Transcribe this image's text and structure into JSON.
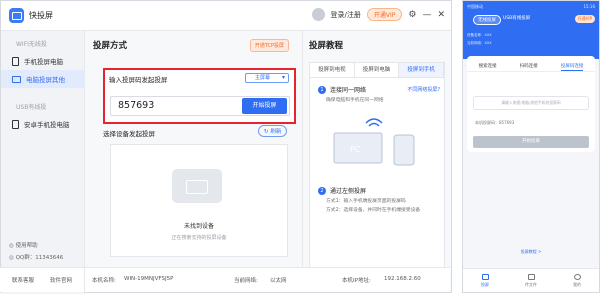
{
  "app": {
    "name": "快投屏"
  },
  "header": {
    "login_label": "登录/注册",
    "vip_label": "开通VIP"
  },
  "sidebar": {
    "section_wifi": "WIFI无线投",
    "items": [
      {
        "label": "手机投屏电脑"
      },
      {
        "label": "电脑投屏其他"
      }
    ],
    "section_usb": "USB有线投",
    "usb_items": [
      {
        "label": "安卓手机投电脑"
      }
    ],
    "help_label": "使用帮助",
    "qq_label": "QQ群：11343646"
  },
  "main": {
    "title": "投屏方式",
    "open_button": "开通TCP投屏",
    "code_section_label": "输入投屏码发起投屏",
    "screen_select": "主屏幕",
    "code_value": "857693",
    "start_button": "开始投屏",
    "device_section_label": "选择设备发起投屏",
    "refresh_button": "刷新",
    "no_device": "未找到设备",
    "no_device_hint": "正在搜索支持的投屏设备"
  },
  "tutorial": {
    "title": "投屏教程",
    "tabs": [
      "投屏到电视",
      "投屏到电脑",
      "投屏到手机"
    ],
    "step1_title": "连接同一网络",
    "step1_hint": "确保电脑和手机在同一网络",
    "step1_link": "不同网络投屏?",
    "step2_title": "通过左侧投屏",
    "step2_line1": "方式1：输入手机端投屏页面的投屏码",
    "step2_line2": "方式2：选择设备，并同时在手机端接受设备"
  },
  "statusbar": {
    "service": "联系客服",
    "software": "软件官网",
    "machine_label": "本机名称:",
    "machine_value": "WIN-19MNJVFSJ5P",
    "network_label": "当前网络:",
    "network_value": "以太网",
    "ip_label": "本机IP地址:",
    "ip_value": "192.168.2.60"
  },
  "phone": {
    "status_left": "中国移动",
    "status_right": "15:16",
    "tab_wireless": "无线投屏",
    "tab_usb": "USB有线投屏",
    "vip": "开通VIP",
    "device_name": "设备名称：XXX",
    "network": "当前网络：XXX",
    "tabs": [
      "搜索连接",
      "扫码连接",
      "投屏码连接"
    ],
    "input_placeholder": "请输入电视/电脑/其他手机的投屏码",
    "code_label": "本机投屏码：857693",
    "start_button": "开始投屏",
    "tutorial_link": "投屏教程 >",
    "nav": [
      "投屏",
      "传文件",
      "我的"
    ]
  },
  "colors": {
    "primary": "#2f6ef3",
    "highlight_border": "#e4242f",
    "vip": "#f06a25"
  }
}
